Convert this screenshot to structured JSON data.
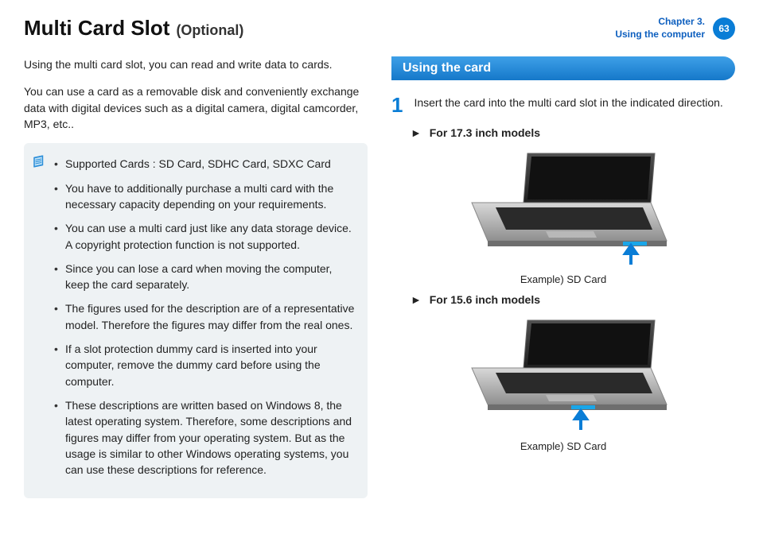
{
  "header": {
    "title_main": "Multi Card Slot",
    "title_optional": "(Optional)",
    "chapter_line1": "Chapter 3.",
    "chapter_line2": "Using the computer",
    "page_number": "63"
  },
  "left": {
    "intro1": "Using the multi card slot, you can read and write data to cards.",
    "intro2": "You can use a card as a removable disk and conveniently exchange data with digital devices such as a digital camera, digital camcorder, MP3, etc..",
    "notes": [
      "Supported Cards : SD Card, SDHC Card, SDXC Card",
      "You have to additionally purchase a multi card with the necessary capacity depending on your requirements.",
      "You can use a multi card just like any data storage device. A copyright protection function is not supported.",
      "Since you can lose a card when moving the computer, keep the card separately.",
      "The figures used for the description are of a representative model. Therefore the figures may differ from the real ones.",
      "If a slot protection dummy card is inserted into your computer, remove the dummy card before using the computer.",
      "These descriptions are written based on Windows 8, the latest operating system. Therefore, some descriptions and figures may differ from your operating system. But as the usage is similar to other Windows operating systems, you can use these descriptions for reference."
    ]
  },
  "right": {
    "section_title": "Using the card",
    "step1_num": "1",
    "step1_text": "Insert the card into the multi card slot in the indicated direction.",
    "sub17": "For 17.3 inch models",
    "sub15": "For 15.6 inch models",
    "caption17": "Example) SD Card",
    "caption15": "Example) SD Card",
    "arrow_char": "►"
  }
}
